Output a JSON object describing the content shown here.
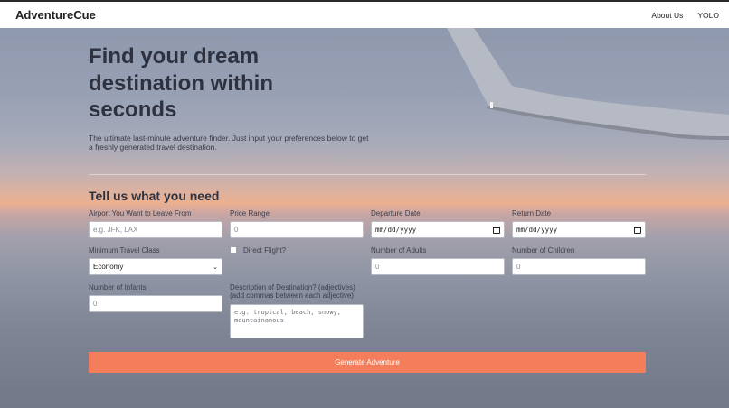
{
  "nav": {
    "brand": "AdventureCue",
    "links": [
      "About Us",
      "YOLO"
    ]
  },
  "hero": {
    "title": "Find your dream destination within seconds",
    "subtitle": "The ultimate last-minute adventure finder. Just input your preferences below to get a freshly generated travel destination."
  },
  "form": {
    "heading": "Tell us what you need",
    "airport": {
      "label": "Airport You Want to Leave From",
      "placeholder": "e.g. JFK, LAX"
    },
    "price": {
      "label": "Price Range",
      "value": "0"
    },
    "departure": {
      "label": "Departure Date",
      "value": "mm/dd/yyyy"
    },
    "return": {
      "label": "Return Date",
      "value": "mm/dd/yyyy"
    },
    "travel_class": {
      "label": "Minimum Travel Class",
      "value": "Economy"
    },
    "direct": {
      "label": "Direct Flight?"
    },
    "adults": {
      "label": "Number of Adults",
      "value": "0"
    },
    "children": {
      "label": "Number of Children",
      "value": "0"
    },
    "infants": {
      "label": "Number of Infants",
      "value": "0"
    },
    "description": {
      "label": "Description of Destination? (adjectives) (add commas between each adjective)",
      "placeholder": "e.g. tropical, beach, snowy, mountainanous"
    },
    "submit_label": "Generate Adventure"
  }
}
